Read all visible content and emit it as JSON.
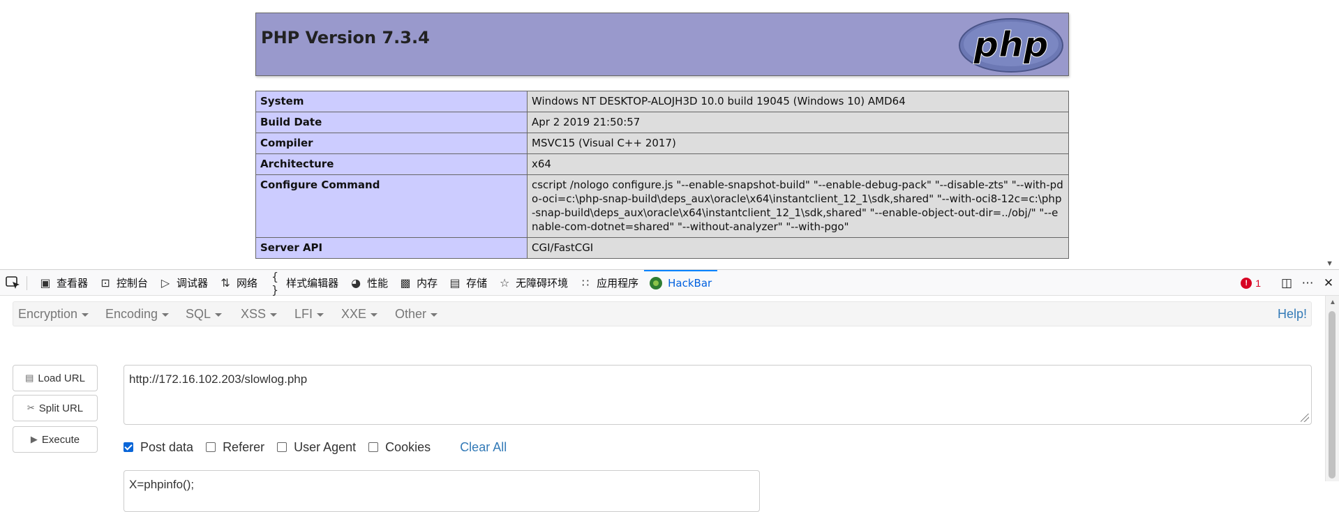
{
  "phpinfo": {
    "title": "PHP Version 7.3.4",
    "logo_text": "php",
    "rows": [
      {
        "key": "System",
        "value": "Windows NT DESKTOP-ALOJH3D 10.0 build 19045 (Windows 10) AMD64"
      },
      {
        "key": "Build Date",
        "value": "Apr 2 2019 21:50:57"
      },
      {
        "key": "Compiler",
        "value": "MSVC15 (Visual C++ 2017)"
      },
      {
        "key": "Architecture",
        "value": "x64"
      },
      {
        "key": "Configure Command",
        "value": "cscript /nologo configure.js \"--enable-snapshot-build\" \"--enable-debug-pack\" \"--disable-zts\" \"--with-pdo-oci=c:\\php-snap-build\\deps_aux\\oracle\\x64\\instantclient_12_1\\sdk,shared\" \"--with-oci8-12c=c:\\php-snap-build\\deps_aux\\oracle\\x64\\instantclient_12_1\\sdk,shared\" \"--enable-object-out-dir=../obj/\" \"--enable-com-dotnet=shared\" \"--without-analyzer\" \"--with-pgo\""
      },
      {
        "key": "Server API",
        "value": "CGI/FastCGI"
      }
    ],
    "colors": {
      "header_bg": "#9999cc",
      "key_bg": "#ccccff",
      "value_bg": "#dddddd"
    }
  },
  "devtools": {
    "tabs": [
      {
        "label": "查看器",
        "icon": "inspector-icon"
      },
      {
        "label": "控制台",
        "icon": "console-icon"
      },
      {
        "label": "调试器",
        "icon": "debugger-icon"
      },
      {
        "label": "网络",
        "icon": "network-icon"
      },
      {
        "label": "样式编辑器",
        "icon": "style-editor-icon"
      },
      {
        "label": "性能",
        "icon": "performance-icon"
      },
      {
        "label": "内存",
        "icon": "memory-icon"
      },
      {
        "label": "存储",
        "icon": "storage-icon"
      },
      {
        "label": "无障碍环境",
        "icon": "accessibility-icon"
      },
      {
        "label": "应用程序",
        "icon": "application-icon"
      },
      {
        "label": "HackBar",
        "icon": "hackbar-icon",
        "active": true
      }
    ],
    "error_count": "1",
    "accent": "#0a84ff"
  },
  "hackbar": {
    "menus": [
      "Encryption",
      "Encoding",
      "SQL",
      "XSS",
      "LFI",
      "XXE",
      "Other"
    ],
    "help": "Help!",
    "buttons": {
      "load": "Load URL",
      "split": "Split URL",
      "execute": "Execute"
    },
    "url": "http://172.16.102.203/slowlog.php",
    "options": [
      {
        "label": "Post data",
        "checked": true
      },
      {
        "label": "Referer",
        "checked": false
      },
      {
        "label": "User Agent",
        "checked": false
      },
      {
        "label": "Cookies",
        "checked": false
      }
    ],
    "clear_all": "Clear All",
    "post_body": "X=phpinfo();"
  }
}
